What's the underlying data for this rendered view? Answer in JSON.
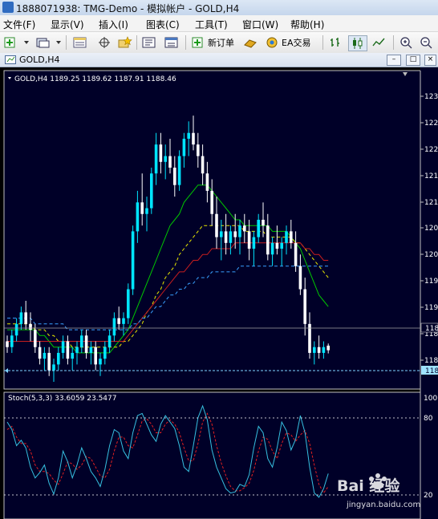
{
  "window": {
    "title": "1888071938: TMG-Demo - 模拟帐户 - GOLD,H4"
  },
  "menu": [
    "文件(F)",
    "显示(V)",
    "插入(I)",
    "图表(C)",
    "工具(T)",
    "窗口(W)",
    "帮助(H)"
  ],
  "toolbar": {
    "new_order": "新订单",
    "ea_trading": "EA交易"
  },
  "chart_tab": {
    "title": "GOLD,H4"
  },
  "main_panel": {
    "header": "GOLD,H4  1189.25 1189.62 1187.91 1188.46"
  },
  "stoch_panel": {
    "header": "Stoch(5,3,3) 33.6059 23.5477",
    "top_label": "100",
    "level_high": "80",
    "level_low": "20"
  },
  "price_axis": [
    "123",
    "122",
    "122",
    "121",
    "121",
    "120",
    "120",
    "119",
    "119",
    "118",
    "118"
  ],
  "price_markers": {
    "current": "118",
    "bid_line": "118"
  },
  "watermark": {
    "brand": "Bai 经验",
    "url": "jingyan.baidu.com"
  },
  "colors": {
    "chart_bg": "#000028",
    "bull": "#00e5ff",
    "bear": "#ffffff",
    "ma_green": "#00c800",
    "ma_red": "#c81e1e",
    "ma_yellow": "#e8e800",
    "ma_blue": "#39a0ff",
    "stoch_main": "#36c0e0",
    "stoch_signal": "#e02020"
  },
  "chart_data": {
    "type": "candlestick",
    "symbol": "GOLD",
    "timeframe": "H4",
    "last_bar": {
      "open": 1189.25,
      "high": 1189.62,
      "low": 1187.91,
      "close": 1188.46
    },
    "ylim": [
      1183,
      1234
    ],
    "candles": [
      [
        1190,
        1191,
        1188,
        1189
      ],
      [
        1189,
        1192,
        1188,
        1191
      ],
      [
        1191,
        1194,
        1190,
        1193
      ],
      [
        1193,
        1196,
        1192,
        1195
      ],
      [
        1195,
        1197,
        1192,
        1193
      ],
      [
        1193,
        1195,
        1190,
        1192
      ],
      [
        1192,
        1193,
        1188,
        1189
      ],
      [
        1189,
        1190,
        1186,
        1187
      ],
      [
        1187,
        1189,
        1185,
        1188
      ],
      [
        1188,
        1189,
        1184,
        1185
      ],
      [
        1185,
        1187,
        1183,
        1186
      ],
      [
        1186,
        1189,
        1185,
        1188
      ],
      [
        1188,
        1191,
        1187,
        1190
      ],
      [
        1190,
        1191,
        1186,
        1187
      ],
      [
        1187,
        1189,
        1185,
        1188
      ],
      [
        1188,
        1190,
        1186,
        1189
      ],
      [
        1189,
        1192,
        1188,
        1191
      ],
      [
        1191,
        1192,
        1187,
        1188
      ],
      [
        1188,
        1190,
        1186,
        1189
      ],
      [
        1189,
        1190,
        1185,
        1186
      ],
      [
        1186,
        1188,
        1184,
        1187
      ],
      [
        1187,
        1190,
        1186,
        1189
      ],
      [
        1189,
        1192,
        1188,
        1191
      ],
      [
        1191,
        1195,
        1190,
        1194
      ],
      [
        1194,
        1196,
        1192,
        1193
      ],
      [
        1193,
        1195,
        1191,
        1194
      ],
      [
        1194,
        1200,
        1193,
        1199
      ],
      [
        1199,
        1210,
        1198,
        1209
      ],
      [
        1209,
        1216,
        1207,
        1214
      ],
      [
        1214,
        1219,
        1210,
        1212
      ],
      [
        1212,
        1215,
        1209,
        1213
      ],
      [
        1213,
        1220,
        1212,
        1219
      ],
      [
        1219,
        1226,
        1217,
        1224
      ],
      [
        1224,
        1226,
        1219,
        1221
      ],
      [
        1221,
        1224,
        1218,
        1222
      ],
      [
        1222,
        1225,
        1219,
        1220
      ],
      [
        1220,
        1222,
        1215,
        1217
      ],
      [
        1217,
        1223,
        1216,
        1222
      ],
      [
        1222,
        1226,
        1220,
        1225
      ],
      [
        1225,
        1228,
        1222,
        1226
      ],
      [
        1226,
        1229,
        1223,
        1224
      ],
      [
        1224,
        1226,
        1220,
        1222
      ],
      [
        1222,
        1224,
        1217,
        1219
      ],
      [
        1219,
        1221,
        1214,
        1216
      ],
      [
        1216,
        1218,
        1210,
        1212
      ],
      [
        1212,
        1215,
        1206,
        1208
      ],
      [
        1208,
        1211,
        1204,
        1209
      ],
      [
        1209,
        1212,
        1205,
        1207
      ],
      [
        1207,
        1210,
        1205,
        1209
      ],
      [
        1209,
        1212,
        1206,
        1208
      ],
      [
        1208,
        1211,
        1205,
        1210
      ],
      [
        1210,
        1212,
        1207,
        1209
      ],
      [
        1209,
        1211,
        1204,
        1206
      ],
      [
        1206,
        1209,
        1203,
        1208
      ],
      [
        1208,
        1212,
        1207,
        1211
      ],
      [
        1211,
        1214,
        1208,
        1210
      ],
      [
        1210,
        1212,
        1204,
        1205
      ],
      [
        1205,
        1208,
        1203,
        1207
      ],
      [
        1207,
        1210,
        1205,
        1206
      ],
      [
        1206,
        1208,
        1203,
        1207
      ],
      [
        1207,
        1210,
        1205,
        1209
      ],
      [
        1209,
        1211,
        1206,
        1207
      ],
      [
        1207,
        1209,
        1202,
        1203
      ],
      [
        1203,
        1205,
        1198,
        1199
      ],
      [
        1199,
        1201,
        1191,
        1193
      ],
      [
        1193,
        1195,
        1187,
        1188
      ],
      [
        1188,
        1190,
        1186,
        1189
      ],
      [
        1189,
        1191,
        1187,
        1188
      ],
      [
        1188,
        1190,
        1187,
        1189
      ],
      [
        1189.25,
        1189.62,
        1187.91,
        1188.46
      ]
    ],
    "moving_averages": [
      {
        "color": "green",
        "values": [
          1192,
          1192,
          1192,
          1192,
          1192,
          1192,
          1192,
          1191,
          1191,
          1190,
          1189,
          1189,
          1189,
          1189,
          1189,
          1188,
          1188,
          1188,
          1188,
          1188,
          1188,
          1188,
          1188,
          1189,
          1190,
          1191,
          1192,
          1194,
          1196,
          1198,
          1200,
          1202,
          1204,
          1206,
          1208,
          1210,
          1211,
          1212,
          1214,
          1215,
          1216,
          1217,
          1217,
          1217,
          1216,
          1215,
          1214,
          1213,
          1212,
          1211,
          1211,
          1210,
          1210,
          1210,
          1210,
          1210,
          1210,
          1209,
          1209,
          1209,
          1209,
          1208,
          1207,
          1206,
          1204,
          1202,
          1200,
          1198,
          1197,
          1196
        ]
      },
      {
        "color": "yellow",
        "values": [
          1193,
          1193,
          1193,
          1193,
          1193,
          1193,
          1192,
          1192,
          1192,
          1191,
          1191,
          1190,
          1190,
          1190,
          1189,
          1189,
          1189,
          1189,
          1189,
          1189,
          1189,
          1189,
          1189,
          1189,
          1189,
          1190,
          1190,
          1191,
          1192,
          1193,
          1195,
          1196,
          1198,
          1199,
          1201,
          1202,
          1203,
          1205,
          1206,
          1207,
          1208,
          1209,
          1210,
          1210,
          1210,
          1210,
          1210,
          1210,
          1210,
          1210,
          1210,
          1209,
          1209,
          1209,
          1209,
          1209,
          1208,
          1208,
          1208,
          1208,
          1208,
          1208,
          1207,
          1207,
          1206,
          1205,
          1204,
          1203,
          1202,
          1201
        ]
      },
      {
        "color": "red",
        "values": [
          1190,
          1190,
          1190,
          1190,
          1190,
          1190,
          1190,
          1190,
          1190,
          1190,
          1190,
          1190,
          1190,
          1190,
          1190,
          1190,
          1190,
          1190,
          1190,
          1190,
          1190,
          1190,
          1190,
          1190,
          1190,
          1190,
          1191,
          1192,
          1193,
          1194,
          1195,
          1196,
          1197,
          1198,
          1199,
          1200,
          1201,
          1202,
          1202,
          1203,
          1204,
          1204,
          1205,
          1205,
          1206,
          1206,
          1206,
          1206,
          1206,
          1207,
          1207,
          1207,
          1207,
          1207,
          1207,
          1207,
          1207,
          1207,
          1207,
          1207,
          1207,
          1207,
          1207,
          1207,
          1206,
          1206,
          1205,
          1205,
          1204,
          1204
        ]
      },
      {
        "color": "blue",
        "values": [
          1194,
          1194,
          1194,
          1194,
          1194,
          1194,
          1193,
          1193,
          1193,
          1193,
          1193,
          1193,
          1193,
          1192,
          1192,
          1192,
          1192,
          1192,
          1192,
          1192,
          1192,
          1192,
          1192,
          1192,
          1192,
          1192,
          1192,
          1193,
          1193,
          1194,
          1194,
          1195,
          1196,
          1196,
          1197,
          1198,
          1198,
          1199,
          1199,
          1200,
          1200,
          1201,
          1201,
          1201,
          1202,
          1202,
          1202,
          1202,
          1202,
          1202,
          1203,
          1203,
          1203,
          1203,
          1203,
          1203,
          1203,
          1203,
          1203,
          1203,
          1203,
          1203,
          1203,
          1203,
          1203,
          1203,
          1203,
          1203,
          1203,
          1203
        ]
      }
    ],
    "stochastic": {
      "params": "5,3,3",
      "main": 33.6059,
      "signal": 23.5477,
      "levels": [
        20,
        80
      ],
      "ylim": [
        0,
        100
      ],
      "main_values": [
        82,
        75,
        60,
        65,
        58,
        40,
        30,
        35,
        42,
        25,
        15,
        30,
        55,
        45,
        30,
        42,
        58,
        48,
        36,
        30,
        22,
        38,
        60,
        75,
        72,
        55,
        48,
        72,
        88,
        90,
        80,
        70,
        64,
        80,
        88,
        82,
        76,
        60,
        40,
        36,
        60,
        86,
        97,
        84,
        56,
        40,
        30,
        20,
        16,
        17,
        24,
        22,
        33,
        58,
        78,
        72,
        48,
        40,
        58,
        82,
        74,
        56,
        66,
        88,
        72,
        40,
        16,
        12,
        20,
        34
      ],
      "signal_values": [
        75,
        78,
        68,
        62,
        62,
        55,
        42,
        36,
        36,
        34,
        28,
        24,
        34,
        45,
        43,
        38,
        42,
        50,
        48,
        40,
        32,
        30,
        38,
        55,
        68,
        68,
        60,
        58,
        70,
        83,
        85,
        80,
        72,
        72,
        80,
        84,
        80,
        72,
        58,
        46,
        46,
        62,
        82,
        90,
        80,
        60,
        44,
        32,
        22,
        18,
        18,
        21,
        25,
        37,
        55,
        68,
        66,
        55,
        48,
        62,
        72,
        70,
        64,
        70,
        74,
        62,
        42,
        24,
        16,
        22
      ]
    }
  }
}
